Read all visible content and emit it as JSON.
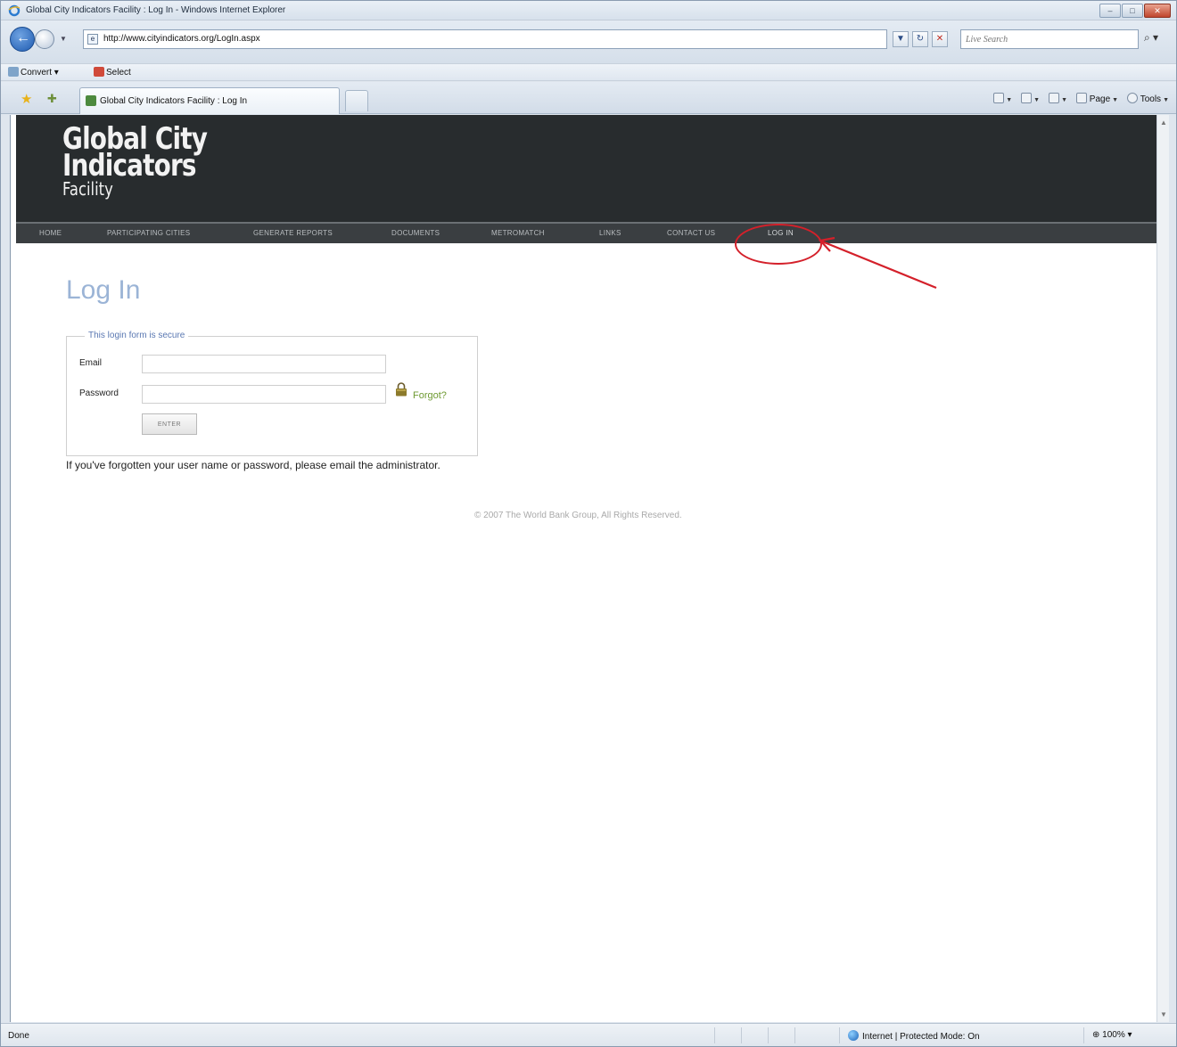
{
  "window": {
    "title": "Global City Indicators Facility : Log In - Windows Internet Explorer"
  },
  "navigation": {
    "url": "http://www.cityindicators.org/LogIn.aspx",
    "search_placeholder": "Live Search"
  },
  "links_bar": {
    "convert_label": "Convert",
    "select_label": "Select"
  },
  "tabs": {
    "active_label": "Global City Indicators Facility : Log In"
  },
  "command_bar": {
    "page_label": "Page",
    "tools_label": "Tools"
  },
  "site": {
    "logo_line1": "Global City",
    "logo_line2": "Indicators",
    "logo_line3": "Facility",
    "nav": [
      {
        "label": "HOME"
      },
      {
        "label": "PARTICIPATING CITIES"
      },
      {
        "label": "GENERATE REPORTS"
      },
      {
        "label": "DOCUMENTS"
      },
      {
        "label": "METROMATCH"
      },
      {
        "label": "LINKS"
      },
      {
        "label": "CONTACT US"
      },
      {
        "label": "LOG IN"
      }
    ]
  },
  "login": {
    "page_title": "Log In",
    "legend": "This login form is secure",
    "email_label": "Email",
    "password_label": "Password",
    "email_value": "",
    "password_value": "",
    "forgot_label": "Forgot?",
    "enter_label": "ENTER",
    "help_text": "If you've forgotten your user name or password, please email the administrator."
  },
  "footer": {
    "copyright": "© 2007 The World Bank Group, All Rights Reserved."
  },
  "status_bar": {
    "status": "Done",
    "zone": "Internet | Protected Mode: On",
    "zoom": "100%"
  },
  "colors": {
    "annotation": "#d4202a",
    "header_bg": "#282c2e",
    "title_blue": "#9bb4d6",
    "forgot_green": "#6f9a33"
  }
}
